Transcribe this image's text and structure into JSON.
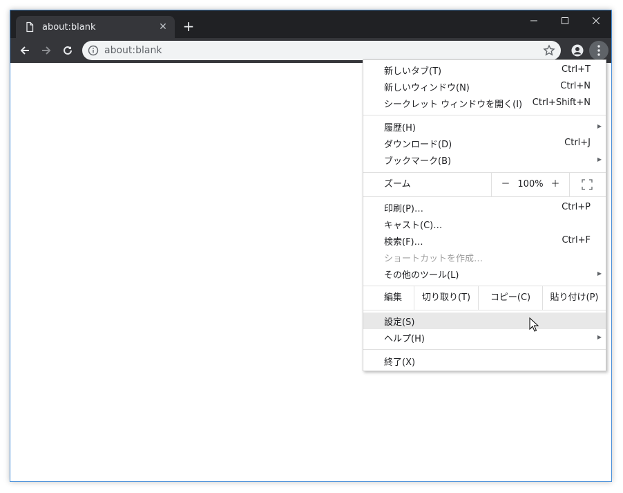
{
  "tab": {
    "title": "about:blank",
    "favicon": "page-icon",
    "close": "✕"
  },
  "new_tab": "+",
  "window_controls": {
    "minimize": "—",
    "maximize": "☐",
    "close": "✕"
  },
  "address": {
    "url": "about:blank"
  },
  "menu": {
    "items_top": [
      {
        "label": "新しいタブ(T)",
        "shortcut": "Ctrl+T"
      },
      {
        "label": "新しいウィンドウ(N)",
        "shortcut": "Ctrl+N"
      },
      {
        "label": "シークレット ウィンドウを開く(I)",
        "shortcut": "Ctrl+Shift+N"
      }
    ],
    "items_history": [
      {
        "label": "履歴(H)",
        "shortcut": "",
        "submenu": true
      },
      {
        "label": "ダウンロード(D)",
        "shortcut": "Ctrl+J"
      },
      {
        "label": "ブックマーク(B)",
        "shortcut": "",
        "submenu": true
      }
    ],
    "zoom": {
      "label": "ズーム",
      "minus": "－",
      "value": "100%",
      "plus": "＋"
    },
    "items_print": [
      {
        "label": "印刷(P)…",
        "shortcut": "Ctrl+P"
      },
      {
        "label": "キャスト(C)…",
        "shortcut": ""
      },
      {
        "label": "検索(F)…",
        "shortcut": "Ctrl+F"
      },
      {
        "label": "ショートカットを作成…",
        "shortcut": "",
        "disabled": true
      },
      {
        "label": "その他のツール(L)",
        "shortcut": "",
        "submenu": true
      }
    ],
    "edit": {
      "label": "編集",
      "cut": "切り取り(T)",
      "copy": "コピー(C)",
      "paste": "貼り付け(P)"
    },
    "settings": "設定(S)",
    "help": "ヘルプ(H)",
    "exit": "終了(X)",
    "submenu_arrow": "▶"
  },
  "colors": {
    "titlebar": "#202124",
    "toolbar": "#35363a",
    "omnibox": "#f1f3f4",
    "hover": "#e8e8e8"
  }
}
